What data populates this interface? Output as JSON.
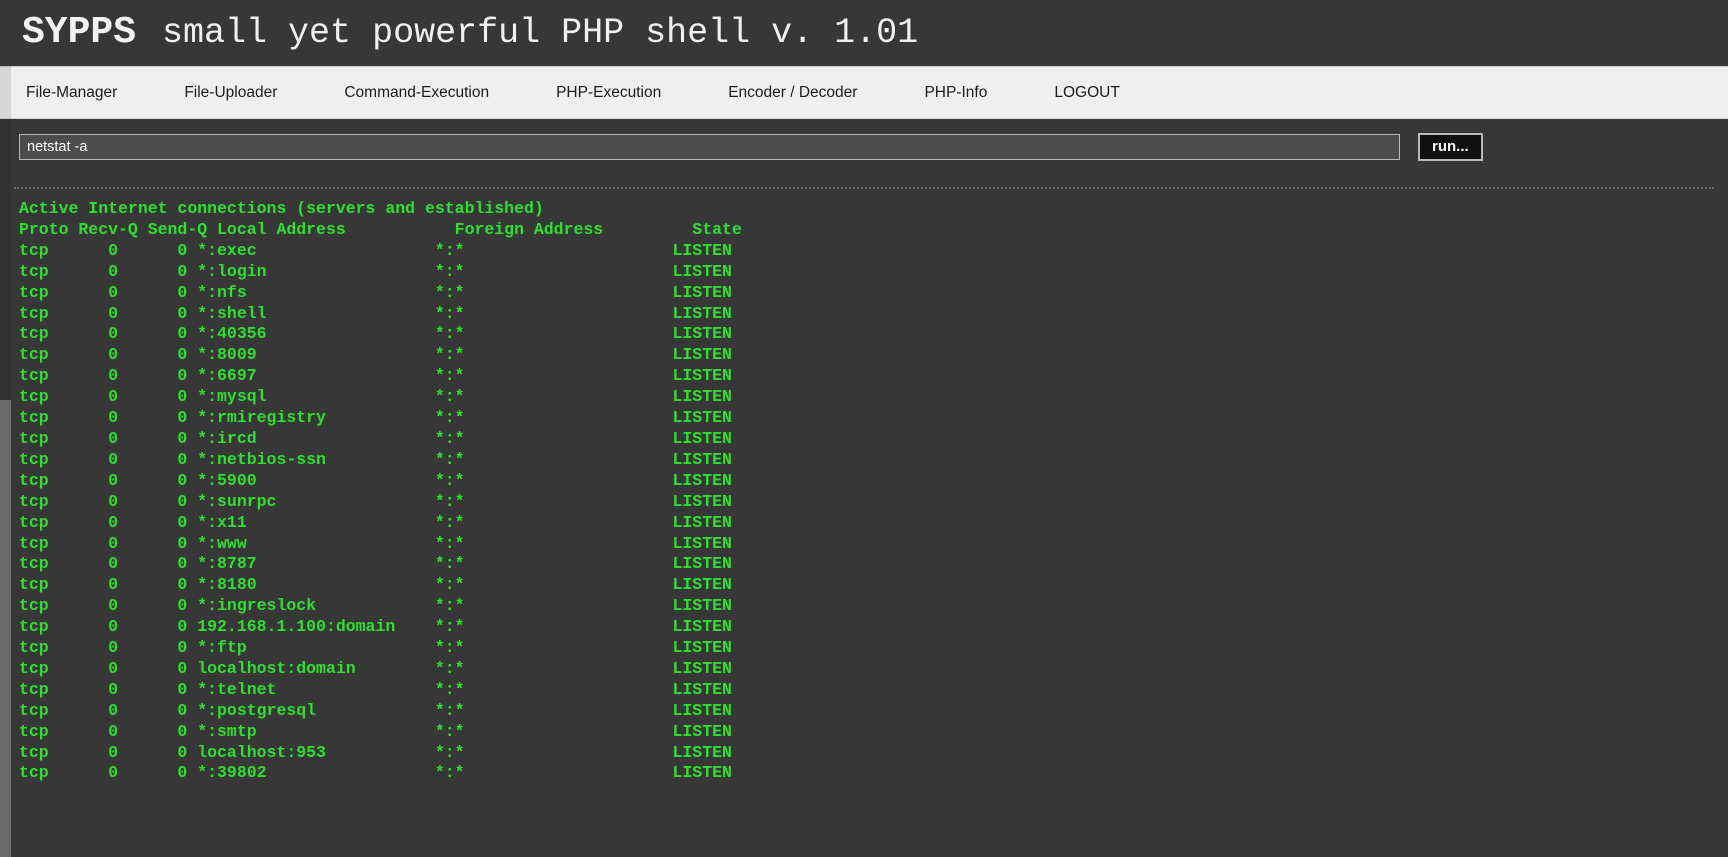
{
  "banner": {
    "brand": "SYPPS",
    "tagline": "small yet powerful PHP shell v. 1.01"
  },
  "nav": {
    "items": [
      {
        "label": "File-Manager",
        "name": "nav-file-manager"
      },
      {
        "label": "File-Uploader",
        "name": "nav-file-uploader"
      },
      {
        "label": "Command-Execution",
        "name": "nav-command-execution"
      },
      {
        "label": "PHP-Execution",
        "name": "nav-php-execution"
      },
      {
        "label": "Encoder / Decoder",
        "name": "nav-encoder-decoder"
      },
      {
        "label": "PHP-Info",
        "name": "nav-php-info"
      },
      {
        "label": "LOGOUT",
        "name": "nav-logout"
      }
    ]
  },
  "command_bar": {
    "input_value": "netstat -a",
    "input_placeholder": "",
    "run_label": "run..."
  },
  "terminal": {
    "title_line": "Active Internet connections (servers and established)",
    "columns": [
      "Proto",
      "Recv-Q",
      "Send-Q",
      "Local Address",
      "Foreign Address",
      "State"
    ],
    "header_line": "Proto Recv-Q Send-Q Local Address           Foreign Address         State",
    "rows": [
      {
        "proto": "tcp",
        "recvq": "0",
        "sendq": "0",
        "local": "*:exec",
        "foreign": "*:*",
        "state": "LISTEN"
      },
      {
        "proto": "tcp",
        "recvq": "0",
        "sendq": "0",
        "local": "*:login",
        "foreign": "*:*",
        "state": "LISTEN"
      },
      {
        "proto": "tcp",
        "recvq": "0",
        "sendq": "0",
        "local": "*:nfs",
        "foreign": "*:*",
        "state": "LISTEN"
      },
      {
        "proto": "tcp",
        "recvq": "0",
        "sendq": "0",
        "local": "*:shell",
        "foreign": "*:*",
        "state": "LISTEN"
      },
      {
        "proto": "tcp",
        "recvq": "0",
        "sendq": "0",
        "local": "*:40356",
        "foreign": "*:*",
        "state": "LISTEN"
      },
      {
        "proto": "tcp",
        "recvq": "0",
        "sendq": "0",
        "local": "*:8009",
        "foreign": "*:*",
        "state": "LISTEN"
      },
      {
        "proto": "tcp",
        "recvq": "0",
        "sendq": "0",
        "local": "*:6697",
        "foreign": "*:*",
        "state": "LISTEN"
      },
      {
        "proto": "tcp",
        "recvq": "0",
        "sendq": "0",
        "local": "*:mysql",
        "foreign": "*:*",
        "state": "LISTEN"
      },
      {
        "proto": "tcp",
        "recvq": "0",
        "sendq": "0",
        "local": "*:rmiregistry",
        "foreign": "*:*",
        "state": "LISTEN"
      },
      {
        "proto": "tcp",
        "recvq": "0",
        "sendq": "0",
        "local": "*:ircd",
        "foreign": "*:*",
        "state": "LISTEN"
      },
      {
        "proto": "tcp",
        "recvq": "0",
        "sendq": "0",
        "local": "*:netbios-ssn",
        "foreign": "*:*",
        "state": "LISTEN"
      },
      {
        "proto": "tcp",
        "recvq": "0",
        "sendq": "0",
        "local": "*:5900",
        "foreign": "*:*",
        "state": "LISTEN"
      },
      {
        "proto": "tcp",
        "recvq": "0",
        "sendq": "0",
        "local": "*:sunrpc",
        "foreign": "*:*",
        "state": "LISTEN"
      },
      {
        "proto": "tcp",
        "recvq": "0",
        "sendq": "0",
        "local": "*:x11",
        "foreign": "*:*",
        "state": "LISTEN"
      },
      {
        "proto": "tcp",
        "recvq": "0",
        "sendq": "0",
        "local": "*:www",
        "foreign": "*:*",
        "state": "LISTEN"
      },
      {
        "proto": "tcp",
        "recvq": "0",
        "sendq": "0",
        "local": "*:8787",
        "foreign": "*:*",
        "state": "LISTEN"
      },
      {
        "proto": "tcp",
        "recvq": "0",
        "sendq": "0",
        "local": "*:8180",
        "foreign": "*:*",
        "state": "LISTEN"
      },
      {
        "proto": "tcp",
        "recvq": "0",
        "sendq": "0",
        "local": "*:ingreslock",
        "foreign": "*:*",
        "state": "LISTEN"
      },
      {
        "proto": "tcp",
        "recvq": "0",
        "sendq": "0",
        "local": "192.168.1.100:domain",
        "foreign": "*:*",
        "state": "LISTEN"
      },
      {
        "proto": "tcp",
        "recvq": "0",
        "sendq": "0",
        "local": "*:ftp",
        "foreign": "*:*",
        "state": "LISTEN"
      },
      {
        "proto": "tcp",
        "recvq": "0",
        "sendq": "0",
        "local": "localhost:domain",
        "foreign": "*:*",
        "state": "LISTEN"
      },
      {
        "proto": "tcp",
        "recvq": "0",
        "sendq": "0",
        "local": "*:telnet",
        "foreign": "*:*",
        "state": "LISTEN"
      },
      {
        "proto": "tcp",
        "recvq": "0",
        "sendq": "0",
        "local": "*:postgresql",
        "foreign": "*:*",
        "state": "LISTEN"
      },
      {
        "proto": "tcp",
        "recvq": "0",
        "sendq": "0",
        "local": "*:smtp",
        "foreign": "*:*",
        "state": "LISTEN"
      },
      {
        "proto": "tcp",
        "recvq": "0",
        "sendq": "0",
        "local": "localhost:953",
        "foreign": "*:*",
        "state": "LISTEN"
      },
      {
        "proto": "tcp",
        "recvq": "0",
        "sendq": "0",
        "local": "*:39802",
        "foreign": "*:*",
        "state": "LISTEN"
      }
    ]
  },
  "colors": {
    "page_background": "#373737",
    "terminal_text": "#2ee02e",
    "nav_background": "#efefef",
    "nav_text": "#1b1b1b",
    "banner_text": "#f2f2f2",
    "input_background": "#4c4c4c",
    "input_border": "#b9b9b9",
    "run_button_background": "#101010"
  }
}
